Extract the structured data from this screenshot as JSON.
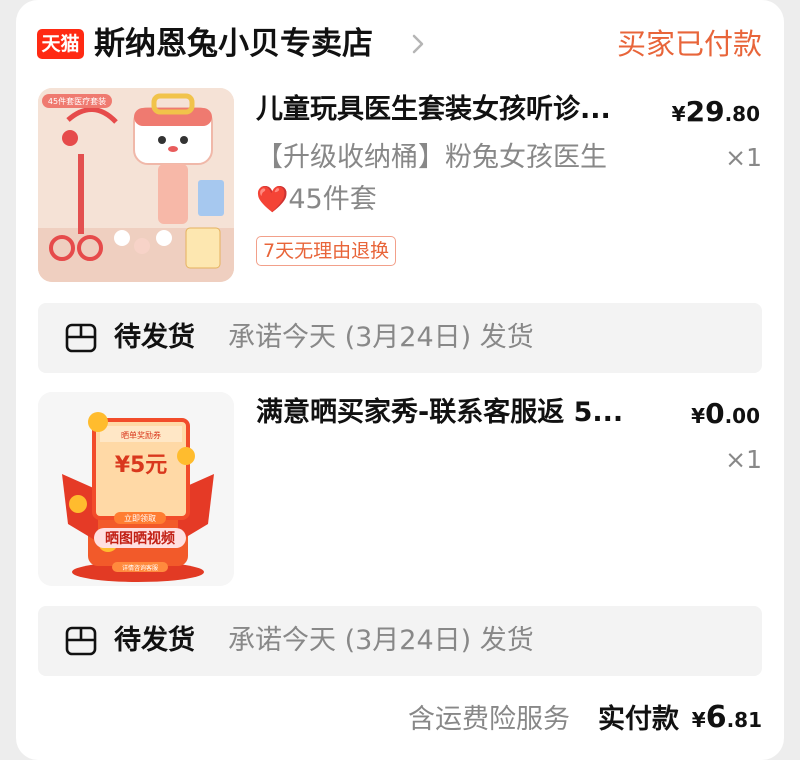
{
  "colors": {
    "brand_red": "#ff2a13",
    "status_orange": "#e8653a",
    "muted_gray": "#888888",
    "ship_bar_bg": "#f3f3f3"
  },
  "shop": {
    "badge": "天猫",
    "name": "斯纳恩兔小贝专卖店",
    "chevron_icon": "chevron-right-icon",
    "status": "买家已付款"
  },
  "items": [
    {
      "image_icon": "toy-doctor-kit-image",
      "image_caption": "45件套医疗套装",
      "title": "儿童玩具医生套装女孩听诊...",
      "price": {
        "symbol": "¥",
        "integer": "29",
        "decimal": ".80"
      },
      "quantity": "×1",
      "spec_line1": "【升级收纳桶】粉兔女孩医生",
      "spec_heart": "❤️",
      "spec_line2": "45件套",
      "tag": "7天无理由退换",
      "shipping": {
        "icon": "package-box-icon",
        "status": "待发货",
        "promise": "承诺今天 (3月24日) 发货"
      }
    },
    {
      "image_icon": "cashback-coupon-image",
      "image_coupon_title": "晒单奖励券",
      "image_coupon_value": "¥5元",
      "image_claim": "立即领取",
      "image_banner": "晒图晒视频",
      "image_footer": "详情咨询客服",
      "title": "满意晒买家秀-联系客服返 5...",
      "price": {
        "symbol": "¥",
        "integer": "0",
        "decimal": ".00"
      },
      "quantity": "×1",
      "shipping": {
        "icon": "package-box-icon",
        "status": "待发货",
        "promise": "承诺今天 (3月24日) 发货"
      }
    }
  ],
  "footer": {
    "note": "含运费险服务",
    "label": "实付款",
    "total": {
      "symbol": "¥",
      "integer": "6",
      "decimal": ".81"
    }
  }
}
